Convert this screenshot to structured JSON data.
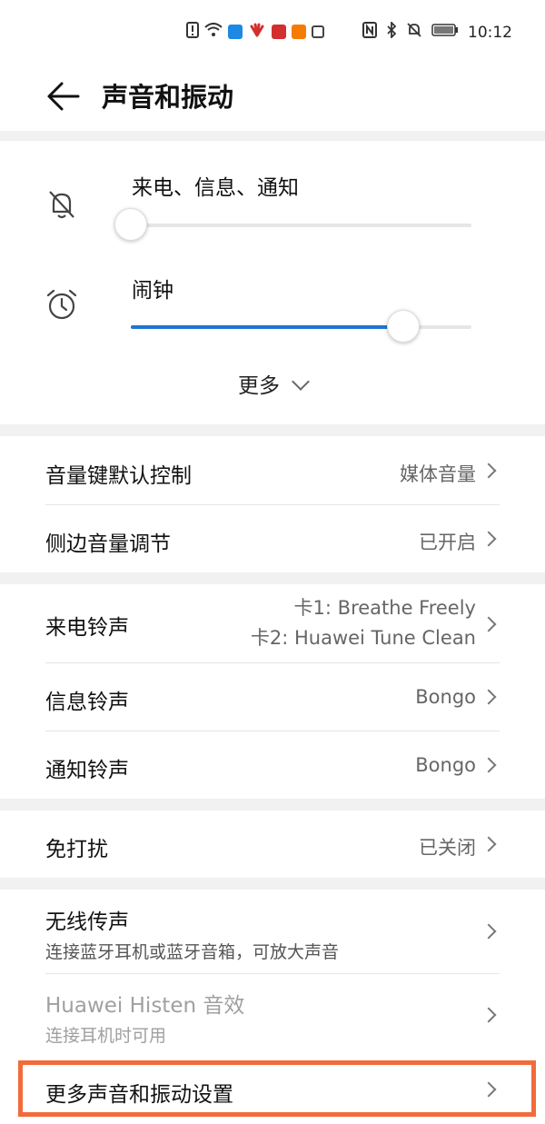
{
  "status_bar": {
    "time": "10:12",
    "icons_left": [
      "alert-icon",
      "wifi-icon",
      "cloud-icon",
      "huawei-icon",
      "app-red-icon",
      "video-icon",
      "shield-icon"
    ],
    "icons_right": [
      "nfc-icon",
      "bluetooth-icon",
      "mute-icon",
      "battery-icon"
    ]
  },
  "header": {
    "title": "声音和振动"
  },
  "volumes": [
    {
      "label": "来电、信息、通知",
      "level": 0.0,
      "icon": "bell-off-icon"
    },
    {
      "label": "闹钟",
      "level": 0.8,
      "icon": "alarm-clock-icon"
    }
  ],
  "more_label": "更多",
  "group_volume_keys": [
    {
      "label": "音量键默认控制",
      "value": "媒体音量"
    },
    {
      "label": "侧边音量调节",
      "value": "已开启"
    }
  ],
  "group_ringtones": {
    "call": {
      "label": "来电铃声",
      "value_line1": "卡1: Breathe Freely",
      "value_line2": "卡2: Huawei Tune Clean"
    },
    "message": {
      "label": "信息铃声",
      "value": "Bongo"
    },
    "notification": {
      "label": "通知铃声",
      "value": "Bongo"
    }
  },
  "do_not_disturb": {
    "label": "免打扰",
    "value": "已关闭"
  },
  "wireless": {
    "label": "无线传声",
    "sub": "连接蓝牙耳机或蓝牙音箱，可放大声音"
  },
  "histen": {
    "label": "Huawei Histen 音效",
    "sub": "连接耳机时可用"
  },
  "more_settings": {
    "label": "更多声音和振动设置"
  },
  "colors": {
    "accent": "#1e75d3",
    "highlight": "#f26b3a",
    "bg": "#f1f1f1"
  }
}
